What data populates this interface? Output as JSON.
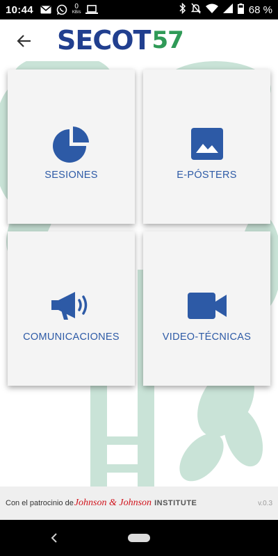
{
  "status_bar": {
    "time": "10:44",
    "network_speed_value": "0",
    "network_speed_unit": "KB/s",
    "battery": "68 %"
  },
  "header": {
    "logo_text": "SECOT",
    "logo_number": "57"
  },
  "tiles": [
    {
      "label": "SESIONES",
      "icon": "pie-chart-icon"
    },
    {
      "label": "E-PÓSTERS",
      "icon": "image-icon"
    },
    {
      "label": "COMUNICACIONES",
      "icon": "megaphone-icon"
    },
    {
      "label": "VIDEO-TÉCNICAS",
      "icon": "video-camera-icon"
    }
  ],
  "footer": {
    "sponsor_prefix": "Con el patrocinio de",
    "sponsor_brand": "Johnson & Johnson",
    "sponsor_suffix": "INSTITUTE",
    "version": "v.0.3"
  },
  "colors": {
    "brand_blue": "#213f8f",
    "brand_green": "#2f9a57",
    "tile_icon_blue": "#2d5aa6",
    "background_art": "#c9e3d7",
    "tile_background": "#f4f4f4"
  }
}
